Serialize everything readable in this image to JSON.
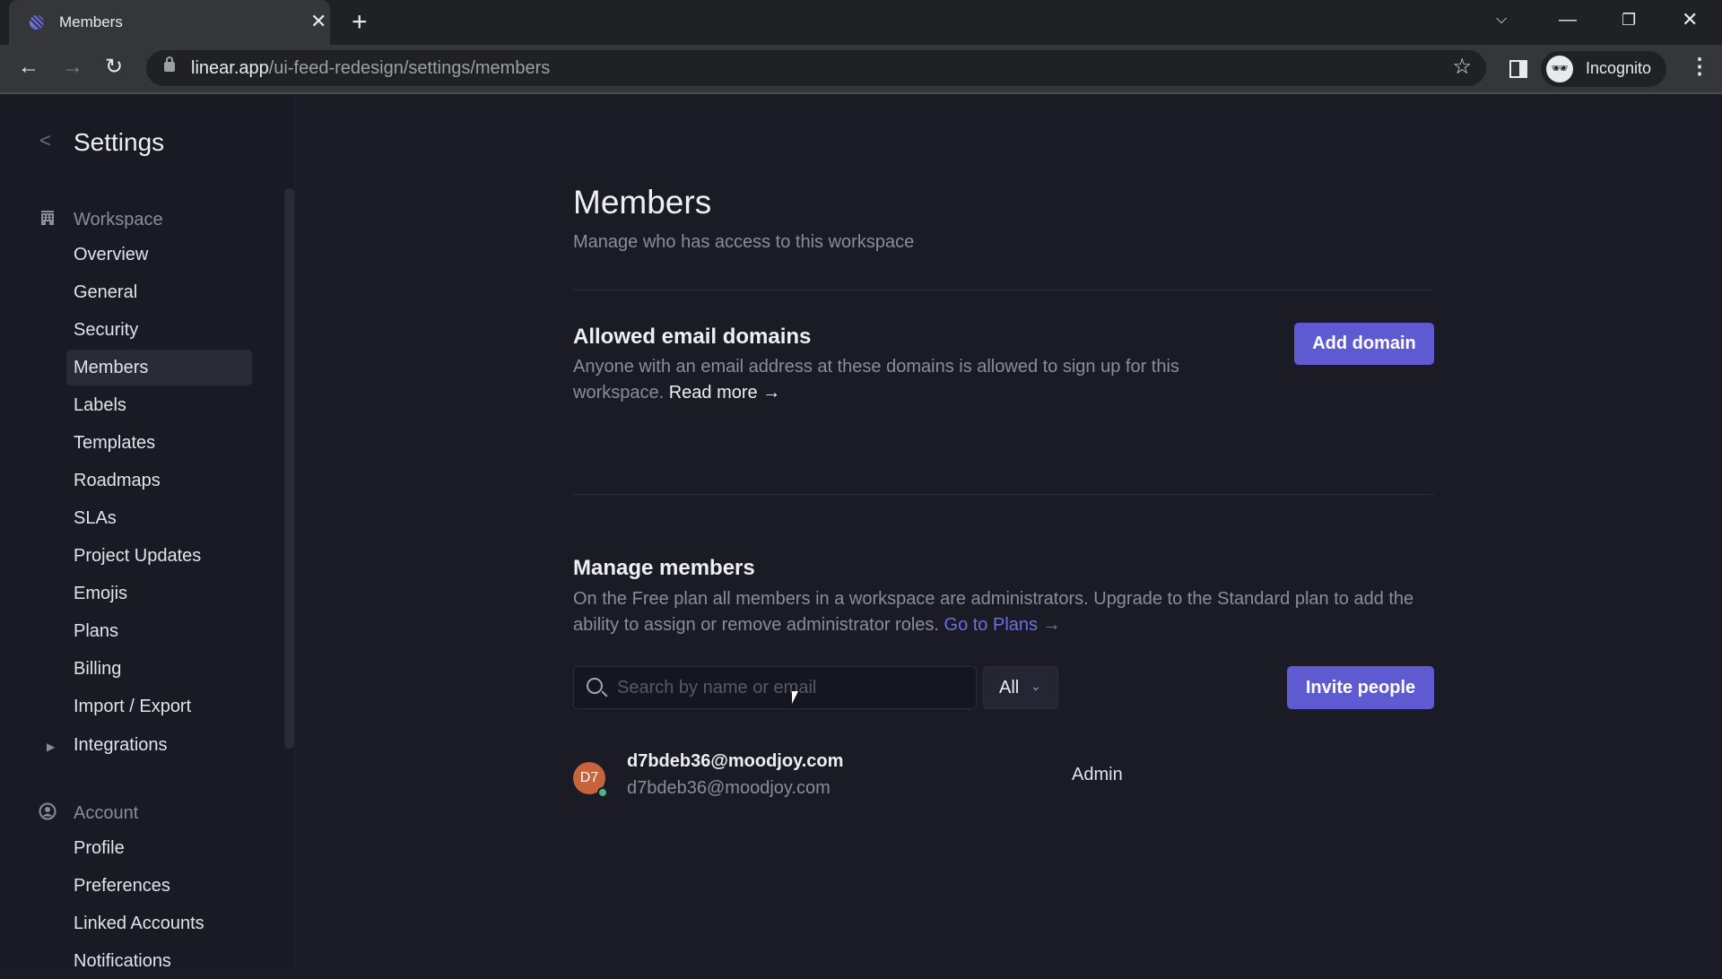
{
  "browser": {
    "tab_title": "Members",
    "url_host": "linear.app",
    "url_path": "/ui-feed-redesign/settings/members",
    "profile_label": "Incognito"
  },
  "sidebar": {
    "title": "Settings",
    "groups": [
      {
        "label": "Workspace",
        "icon": "building-icon",
        "items": [
          {
            "label": "Overview"
          },
          {
            "label": "General"
          },
          {
            "label": "Security"
          },
          {
            "label": "Members",
            "active": true
          },
          {
            "label": "Labels"
          },
          {
            "label": "Templates"
          },
          {
            "label": "Roadmaps"
          },
          {
            "label": "SLAs"
          },
          {
            "label": "Project Updates"
          },
          {
            "label": "Emojis"
          },
          {
            "label": "Plans"
          },
          {
            "label": "Billing"
          },
          {
            "label": "Import / Export"
          },
          {
            "label": "Integrations",
            "expandable": true
          }
        ]
      },
      {
        "label": "Account",
        "icon": "user-circle-icon",
        "items": [
          {
            "label": "Profile"
          },
          {
            "label": "Preferences"
          },
          {
            "label": "Linked Accounts"
          },
          {
            "label": "Notifications"
          }
        ]
      }
    ]
  },
  "page": {
    "title": "Members",
    "subtitle": "Manage who has access to this workspace"
  },
  "domains": {
    "title": "Allowed email domains",
    "description": "Anyone with an email address at these domains is allowed to sign up for this workspace.",
    "link": "Read more →",
    "button": "Add domain"
  },
  "manage": {
    "title": "Manage members",
    "description": "On the Free plan all members in a workspace are administrators. Upgrade to the Standard plan to add the ability to assign or remove administrator roles.",
    "link": "Go to Plans →",
    "search_placeholder": "Search by name or email",
    "search_value": "",
    "filter_value": "All",
    "invite_button": "Invite people"
  },
  "members": [
    {
      "initials": "D7",
      "name": "d7bdeb36@moodjoy.com",
      "email": "d7bdeb36@moodjoy.com",
      "role": "Admin",
      "online": true,
      "avatar_color": "#c8643d"
    }
  ],
  "colors": {
    "accent": "#5e5ad2",
    "background": "#1b1b25",
    "sidebar": "#191a23",
    "presence": "#4cb782"
  }
}
